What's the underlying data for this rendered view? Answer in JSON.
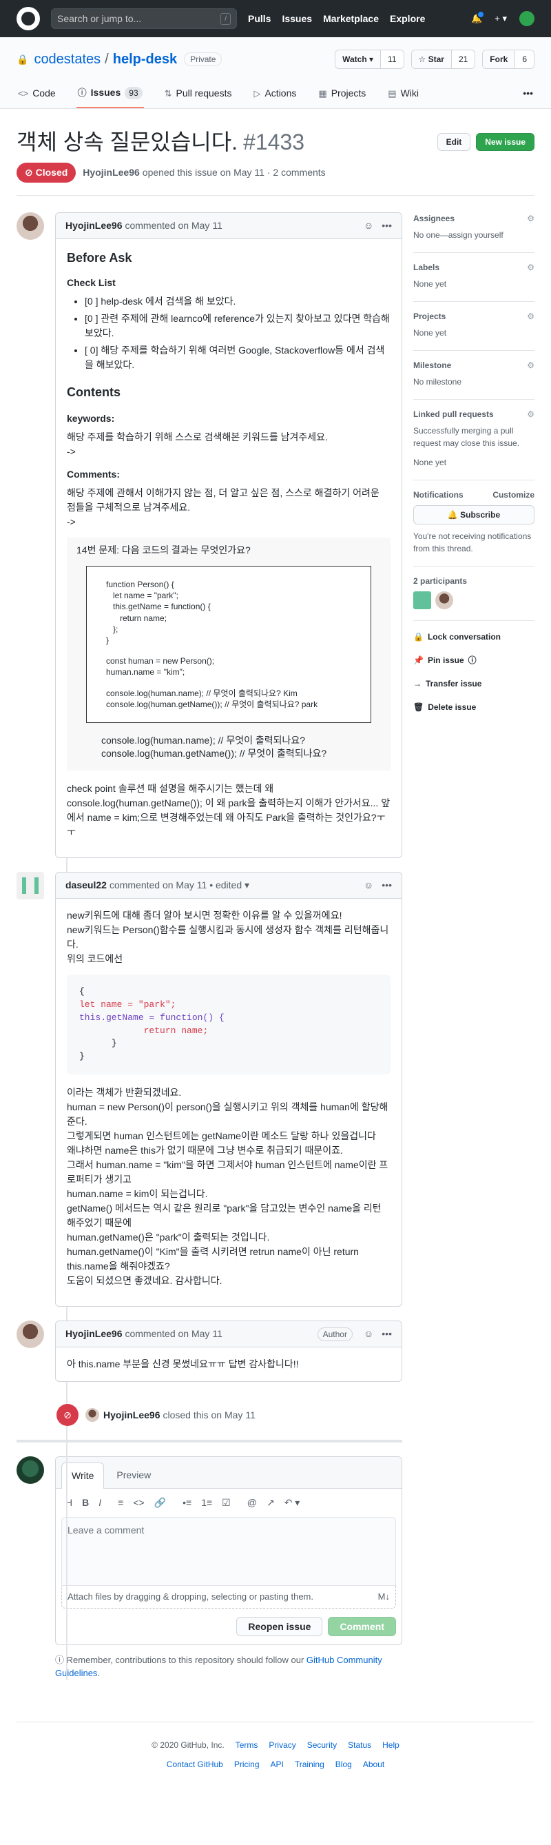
{
  "header": {
    "search_placeholder": "Search or jump to...",
    "slash": "/",
    "nav": [
      "Pulls",
      "Issues",
      "Marketplace",
      "Explore"
    ],
    "plus": "+ ▾"
  },
  "repo": {
    "owner": "codestates",
    "name": "help-desk",
    "visibility": "Private",
    "watch_label": "Watch ▾",
    "watch_count": "11",
    "star_label": "☆ Star",
    "star_count": "21",
    "fork_label": "Fork",
    "fork_count": "6"
  },
  "tabs": [
    {
      "label": "Code",
      "icon": "<>"
    },
    {
      "label": "Issues",
      "icon": "ⓘ",
      "count": "93"
    },
    {
      "label": "Pull requests",
      "icon": "⇅"
    },
    {
      "label": "Actions",
      "icon": "▷"
    },
    {
      "label": "Projects",
      "icon": "▦"
    },
    {
      "label": "Wiki",
      "icon": "▤"
    }
  ],
  "more_menu": "•••",
  "issue": {
    "title": "객체 상속 질문있습니다.",
    "number": "#1433",
    "edit_label": "Edit",
    "new_label": "New issue",
    "state": "⊘ Closed",
    "author": "HyojinLee96",
    "meta": "opened this issue on May 11 · 2 comments"
  },
  "c1": {
    "author": "HyojinLee96",
    "meta": "commented on May 11",
    "h_before": "Before Ask",
    "h_check": "Check List",
    "checks": [
      "[0 ] help-desk 에서 검색을 해 보았다.",
      "[0 ] 관련 주제에 관해 learnco에 reference가 있는지 찾아보고 있다면 학습해보았다.",
      "[ 0] 해당 주제를 학습하기 위해 여러번 Google, Stackoverflow등 에서 검색을 해보았다."
    ],
    "h_contents": "Contents",
    "h_keywords": "keywords:",
    "kw_text": "해당 주제를 학습하기 위해 스스로 검색해본 키워드를 남겨주세요.",
    "arrow1": "->",
    "h_comments": "Comments:",
    "cm_text": "해당 주제에 관해서 이해가지 않는 점, 더 알고 싶은 점, 스스로 해결하기 어려운 점들을 구체적으로 남겨주세요.",
    "arrow2": "->",
    "img_q": "14번 문제: 다음 코드의 결과는 무엇인가요?",
    "img_code": [
      "function Person() {",
      "  let name = \"park\";",
      "  this.getName = function() {",
      "    return name;",
      "  };",
      "}",
      "",
      "const human = new Person();",
      "human.name = \"kim\";",
      "",
      "console.log(human.name);  // 무엇이 출력되나요?    Kim",
      "console.log(human.getName()); // 무엇이 출력되나요? park"
    ],
    "img_lines": [
      "console.log(human.name);   // 무엇이 출력되나요?",
      "console.log(human.getName()); // 무엇이 출력되나요?"
    ],
    "closing": "check point 솔루션 때 설명을 해주시기는 했는데 왜 console.log(human.getName()); 이 왜 park을 출력하는지 이해가 안가서요... 앞에서 name = kim;으로 변경해주었는데 왜 아직도 Park을 출력하는 것인가요?ㅜㅜ"
  },
  "c2": {
    "author": "daseul22",
    "meta": "commented on May 11 • edited ▾",
    "intro": [
      "new키워드에 대해 좀더 알아 보시면 정확한 이유를 알 수 있을꺼에요!",
      "new키워드는 Person()함수를 실행시킴과 동시에 생성자 함수 객체를 리턴해줍니다.",
      "위의 코드에선"
    ],
    "code": [
      "{",
      "let name = \"park\";",
      "this.getName = function() {",
      "    return name;",
      "  }",
      "}"
    ],
    "body": [
      "이라는 객체가 반환되겠네요.",
      "human = new Person()이 person()을 실행시키고 위의 객체를 human에 할당해준다.",
      "그렇게되면 human 인스턴트에는 getName이란 메소드 달랑 하나 있을겁니다",
      "왜냐하면 name은 this가 없기 때문에 그냥 변수로 취급되기 때문이죠.",
      "그래서 human.name = \"kim\"을 하면 그제서야 human 인스턴트에 name이란 프로퍼티가 생기고",
      "human.name = kim이 되는겁니다.",
      "getName() 메서드는 역시 같은 원리로 \"park\"을 담고있는 변수인 name을 리턴 해주었기 때문에",
      "human.getName()은 \"park\"이 출력되는 것입니다.",
      "human.getName()이 \"Kim\"을 출력 시키려면 retrun name이 아닌 return this.name을 해줘야겠죠?",
      "도움이 되셨으면 좋겠네요. 감사합니다."
    ]
  },
  "c3": {
    "author": "HyojinLee96",
    "meta": "commented on May 11",
    "badge": "Author",
    "body": "아 this.name 부분을 신경 못썼네요ㅠㅠ 답변 감사합니다!!"
  },
  "closed_event": {
    "icon": "⊘",
    "author": "HyojinLee96",
    "text": "closed this on May 11"
  },
  "new_comment": {
    "tab_write": "Write",
    "tab_preview": "Preview",
    "tools": [
      "H",
      "B",
      "I",
      "≡",
      "<>",
      "🔗",
      "•≡",
      "1≡",
      "☑",
      "@",
      "↗",
      "↶ ▾"
    ],
    "placeholder": "Leave a comment",
    "attach": "Attach files by dragging & dropping, selecting or pasting them.",
    "md": "M↓",
    "reopen": "Reopen issue",
    "comment": "Comment"
  },
  "remember": {
    "text": "Remember, contributions to this repository should follow our ",
    "link": "GitHub Community Guidelines",
    "end": "."
  },
  "sidebar": {
    "assignees_h": "Assignees",
    "assignees_v": "No one—assign yourself",
    "labels_h": "Labels",
    "labels_v": "None yet",
    "projects_h": "Projects",
    "projects_v": "None yet",
    "milestone_h": "Milestone",
    "milestone_v": "No milestone",
    "linked_h": "Linked pull requests",
    "linked_desc": "Successfully merging a pull request may close this issue.",
    "linked_v": "None yet",
    "notif_h": "Notifications",
    "customize": "Customize",
    "subscribe": "🔔 Subscribe",
    "notif_text": "You're not receiving notifications from this thread.",
    "participants": "2 participants",
    "lock": "Lock conversation",
    "pin": "Pin issue",
    "transfer": "Transfer issue",
    "delete": "Delete issue"
  },
  "footer": {
    "copyright": "© 2020 GitHub, Inc.",
    "row1": [
      "Terms",
      "Privacy",
      "Security",
      "Status",
      "Help"
    ],
    "row2": [
      "Contact GitHub",
      "Pricing",
      "API",
      "Training",
      "Blog",
      "About"
    ]
  }
}
